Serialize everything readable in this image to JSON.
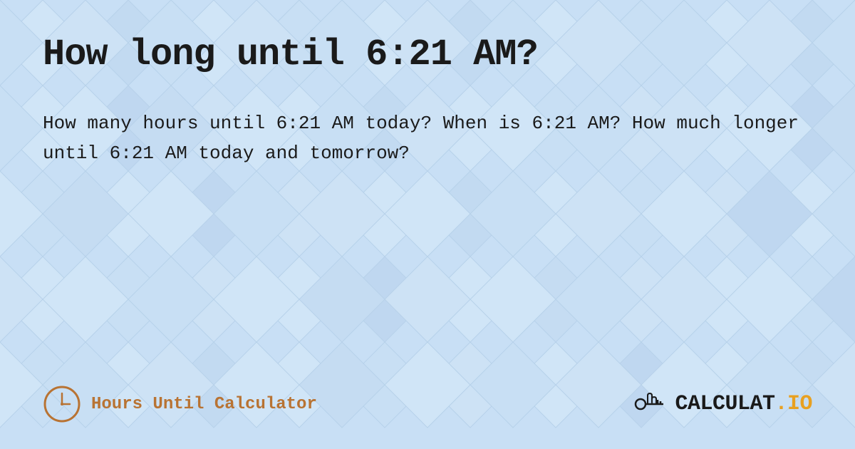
{
  "page": {
    "title": "How long until 6:21 AM?",
    "description": "How many hours until 6:21 AM today? When is 6:21 AM? How much longer until 6:21 AM today and tomorrow?",
    "background_color": "#c8dff5"
  },
  "footer": {
    "brand_left_label": "Hours Until Calculator",
    "brand_right_text": "CALCULAT",
    "brand_right_suffix": ".IO"
  }
}
